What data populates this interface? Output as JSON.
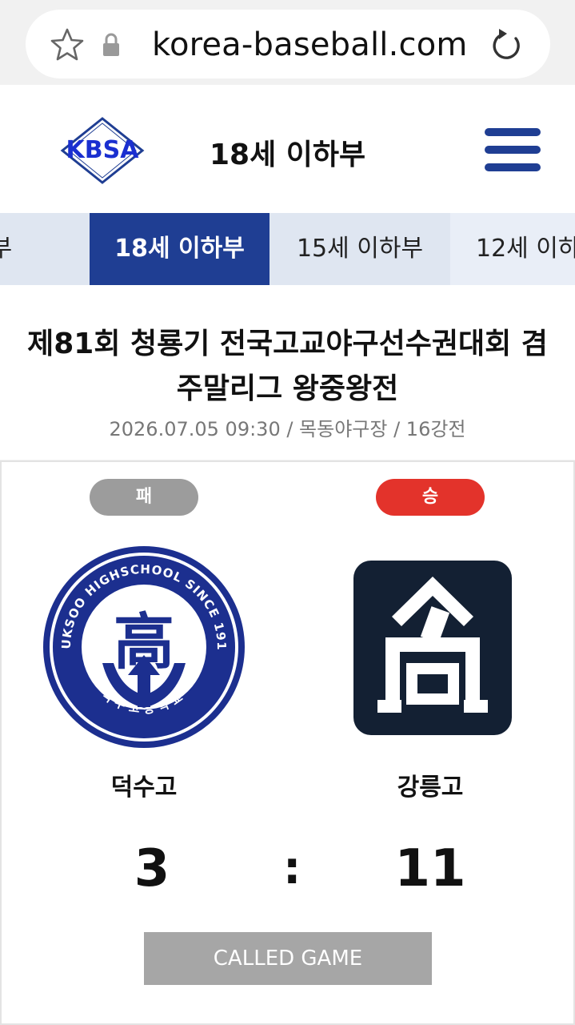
{
  "browser": {
    "url": "korea-baseball.com",
    "star_icon": "star-outline-icon",
    "lock_icon": "lock-icon",
    "reload_icon": "reload-icon"
  },
  "header": {
    "logo_text": "KBSA",
    "title": "18세 이하부",
    "menu_icon": "hamburger-menu-icon",
    "brand_color": "#1f3e93"
  },
  "tabs": [
    {
      "label": "학부",
      "active": false
    },
    {
      "label": "18세 이하부",
      "active": true
    },
    {
      "label": "15세 이하부",
      "active": false
    },
    {
      "label": "12세 이하",
      "active": false
    }
  ],
  "game": {
    "title_line1": "제81회 청룡기 전국고교야구선수권대회 겸",
    "title_line2": "주말리그 왕중왕전",
    "meta": "2026.07.05 09:30 / 목동야구장 / 16강전",
    "home": {
      "result": "패",
      "result_color": "#9c9c9c",
      "name": "덕수고",
      "score": "3",
      "emblem_text": "DUKSOO HIGHSCHOOL SINCE 1910",
      "emblem_korean": "덕수고등학교",
      "emblem_center": "高"
    },
    "away": {
      "result": "승",
      "result_color": "#e3332b",
      "name": "강릉고",
      "score": "11"
    },
    "separator": ":",
    "status": "CALLED GAME"
  }
}
